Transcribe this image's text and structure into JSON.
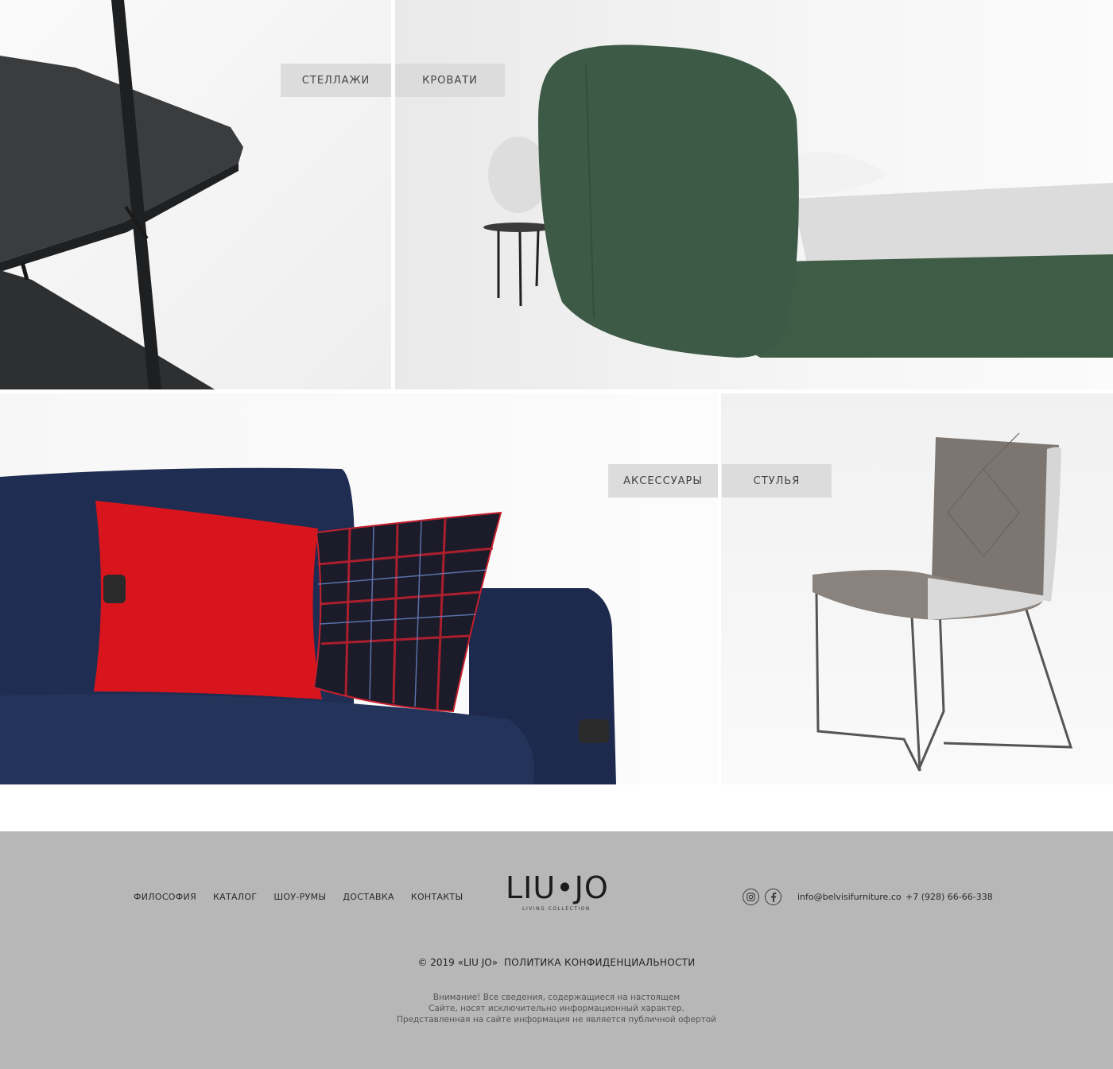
{
  "categories": {
    "shelves": "СТЕЛЛАЖИ",
    "beds": "КРОВАТИ",
    "accessories": "АКСЕССУАРЫ",
    "chairs": "СТУЛЬЯ"
  },
  "footer": {
    "nav": [
      "ФИЛОСОФИЯ",
      "КАТАЛОГ",
      "ШОУ-РУМЫ",
      "ДОСТАВКА",
      "КОНТАКТЫ"
    ],
    "logo": {
      "brand": "LIU•JO",
      "tagline": "LIVING COLLECTION"
    },
    "social": [
      "instagram-icon",
      "facebook-icon"
    ],
    "email": "info@belvisifurniture.co",
    "phone": "+7 (928) 66-66-338",
    "copyright": "© 2019 «LIU JO»",
    "privacy": "ПОЛИТИКА КОНФИДЕНЦИАЛЬНОСТИ",
    "disclaimer": [
      "Внимание! Все сведения, содержащиеся на настоящем",
      "Сайте, носят исключительно информационный характер.",
      "Представленная на сайте информация не является публичной офертой"
    ]
  },
  "colors": {
    "footer_bg": "#b7b7b7",
    "button_bg": "#dcdcdc",
    "bed_green": "#3c5a45",
    "sofa_blue": "#1f2b4f",
    "pillow_red": "#d8141c"
  }
}
